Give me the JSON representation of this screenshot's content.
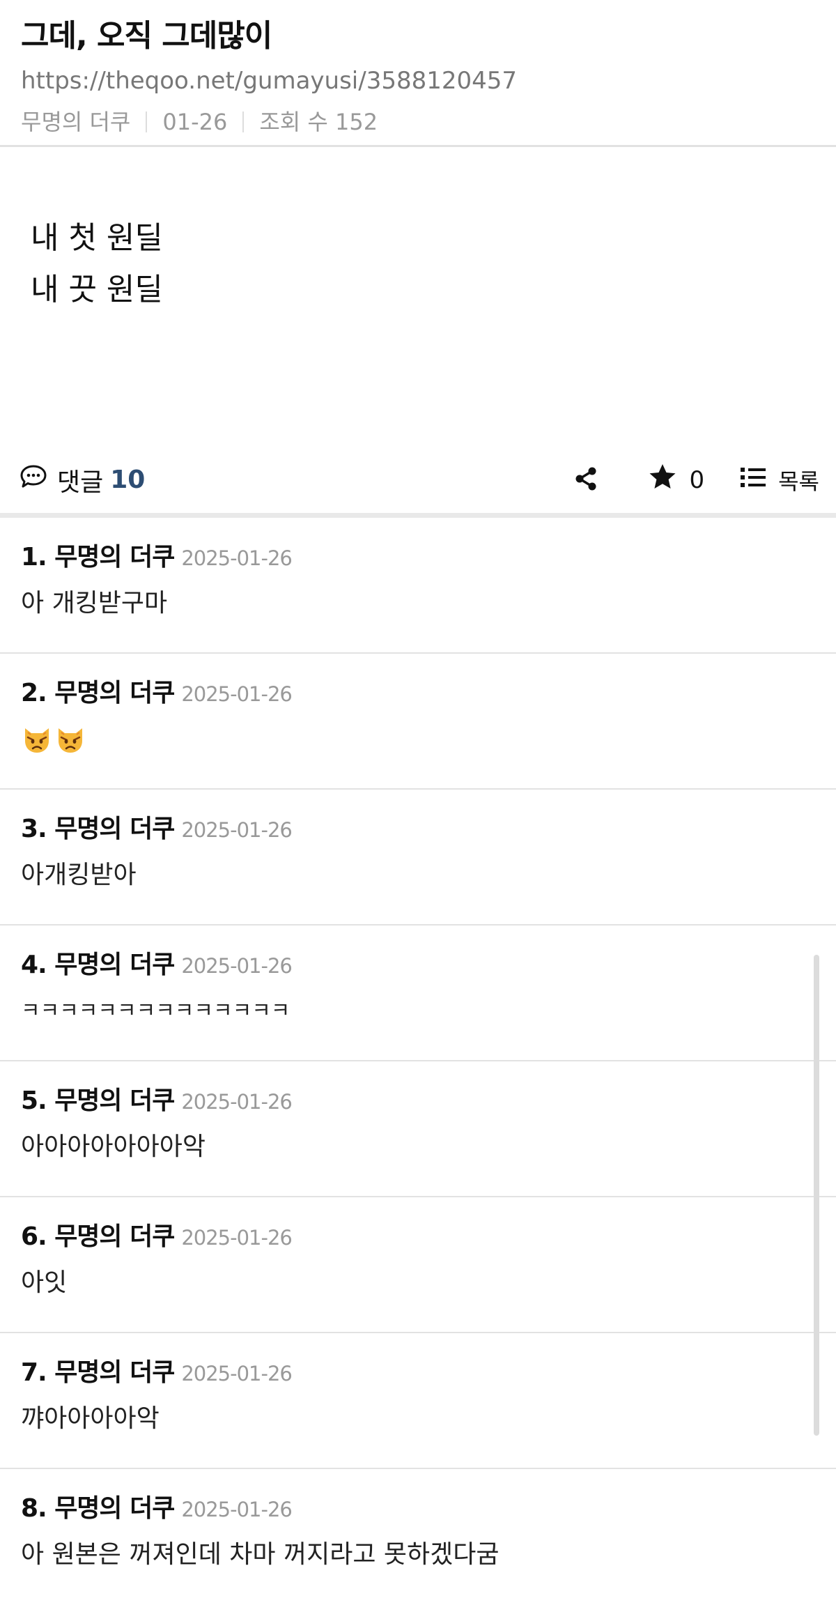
{
  "post": {
    "title": "그데, 오직 그데많이",
    "url": "https://theqoo.net/gumayusi/3588120457",
    "author": "무명의 더쿠",
    "date": "01-26",
    "views": "조회 수 152",
    "content": [
      "내 첫 원딜",
      "내 끗 원딜"
    ]
  },
  "toolbar": {
    "comments_label": "댓글",
    "comments_count": "10",
    "stars_count": "0",
    "list_label": "목록"
  },
  "comments": [
    {
      "num": "1.",
      "author": "무명의 더쿠",
      "date": "2025-01-26",
      "text": "아 개킹받구마"
    },
    {
      "num": "2.",
      "author": "무명의 더쿠",
      "date": "2025-01-26",
      "text": "😾😾"
    },
    {
      "num": "3.",
      "author": "무명의 더쿠",
      "date": "2025-01-26",
      "text": "아개킹받아"
    },
    {
      "num": "4.",
      "author": "무명의 더쿠",
      "date": "2025-01-26",
      "text": "ㅋㅋㅋㅋㅋㅋㅋㅋㅋㅋㅋㅋㅋㅋ"
    },
    {
      "num": "5.",
      "author": "무명의 더쿠",
      "date": "2025-01-26",
      "text": "아아아아아아아악"
    },
    {
      "num": "6.",
      "author": "무명의 더쿠",
      "date": "2025-01-26",
      "text": "아잇"
    },
    {
      "num": "7.",
      "author": "무명의 더쿠",
      "date": "2025-01-26",
      "text": "꺄아아아아악"
    },
    {
      "num": "8.",
      "author": "무명의 더쿠",
      "date": "2025-01-26",
      "text": "아 원본은 꺼져인데 차마 꺼지라고 못하겠다굼"
    }
  ],
  "icons": {
    "comment": "speech-bubble-icon",
    "share": "share-icon",
    "star": "star-icon",
    "list": "list-icon",
    "emoji": "pouting-cat-icon"
  }
}
